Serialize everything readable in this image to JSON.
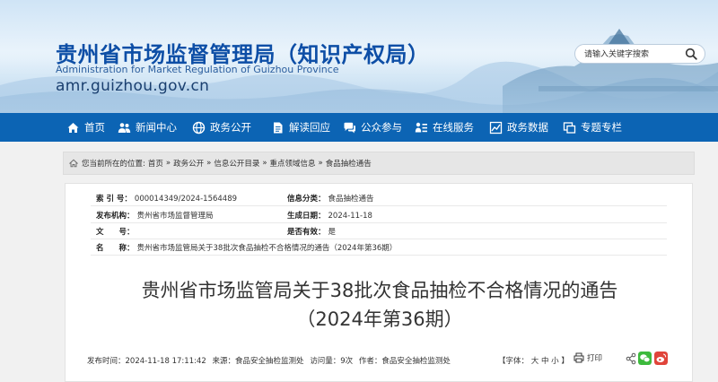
{
  "header": {
    "title": "贵州省市场监督管理局（知识产权局）",
    "title_en": "Administration for Market Regulation of Guizhou Province",
    "url": "amr.guizhou.gov.cn",
    "search_placeholder": "请输入关键字搜索"
  },
  "nav": {
    "items": [
      {
        "label": "首页",
        "icon": "home-icon"
      },
      {
        "label": "新闻中心",
        "icon": "people-icon"
      },
      {
        "label": "政务公开",
        "icon": "globe-icon"
      },
      {
        "label": "解读回应",
        "icon": "document-icon"
      },
      {
        "label": "公众参与",
        "icon": "chat-icon"
      },
      {
        "label": "在线服务",
        "icon": "person-list-icon"
      },
      {
        "label": "政务数据",
        "icon": "chart-icon"
      },
      {
        "label": "专题专栏",
        "icon": "window-icon"
      }
    ]
  },
  "breadcrumb": {
    "prefix": "您当前所在的位置:",
    "items": [
      "首页",
      "政务公开",
      "信息公开目录",
      "重点领域信息",
      "食品抽检通告"
    ],
    "separator": "»"
  },
  "meta": {
    "index_label": "索 引 号：",
    "index_value": "000014349/2024-1564489",
    "category_label": "信息分类：",
    "category_value": "食品抽检通告",
    "publisher_label": "发布机构：",
    "publisher_value": "贵州省市场监督管理局",
    "date_label": "生成日期：",
    "date_value": "2024-11-18",
    "docno_label": "文　　号：",
    "docno_value": "",
    "valid_label": "是否有效：",
    "valid_value": "是",
    "name_label": "名　　称：",
    "name_value": "贵州省市场监管局关于38批次食品抽检不合格情况的通告（2024年第36期）"
  },
  "article": {
    "title_line1": "贵州省市场监管局关于38批次食品抽检不合格情况的通告",
    "title_line2": "（2024年第36期）",
    "publish_time": "发布时间：2024-11-18 17:11:42",
    "source": "来源：食品安全抽检监测处",
    "views": "访问量：9次",
    "author": "作者：食品安全抽检监测处",
    "fontsize_prefix": "【字体：",
    "font_large": "大",
    "font_medium": "中",
    "font_small": "小",
    "fontsize_suffix": "】",
    "print_label": "打印"
  },
  "colors": {
    "nav_bg": "#0c64b4",
    "title_blue": "#0d4ea6",
    "wechat": "#3dba3d",
    "weibo": "#e0443a"
  }
}
